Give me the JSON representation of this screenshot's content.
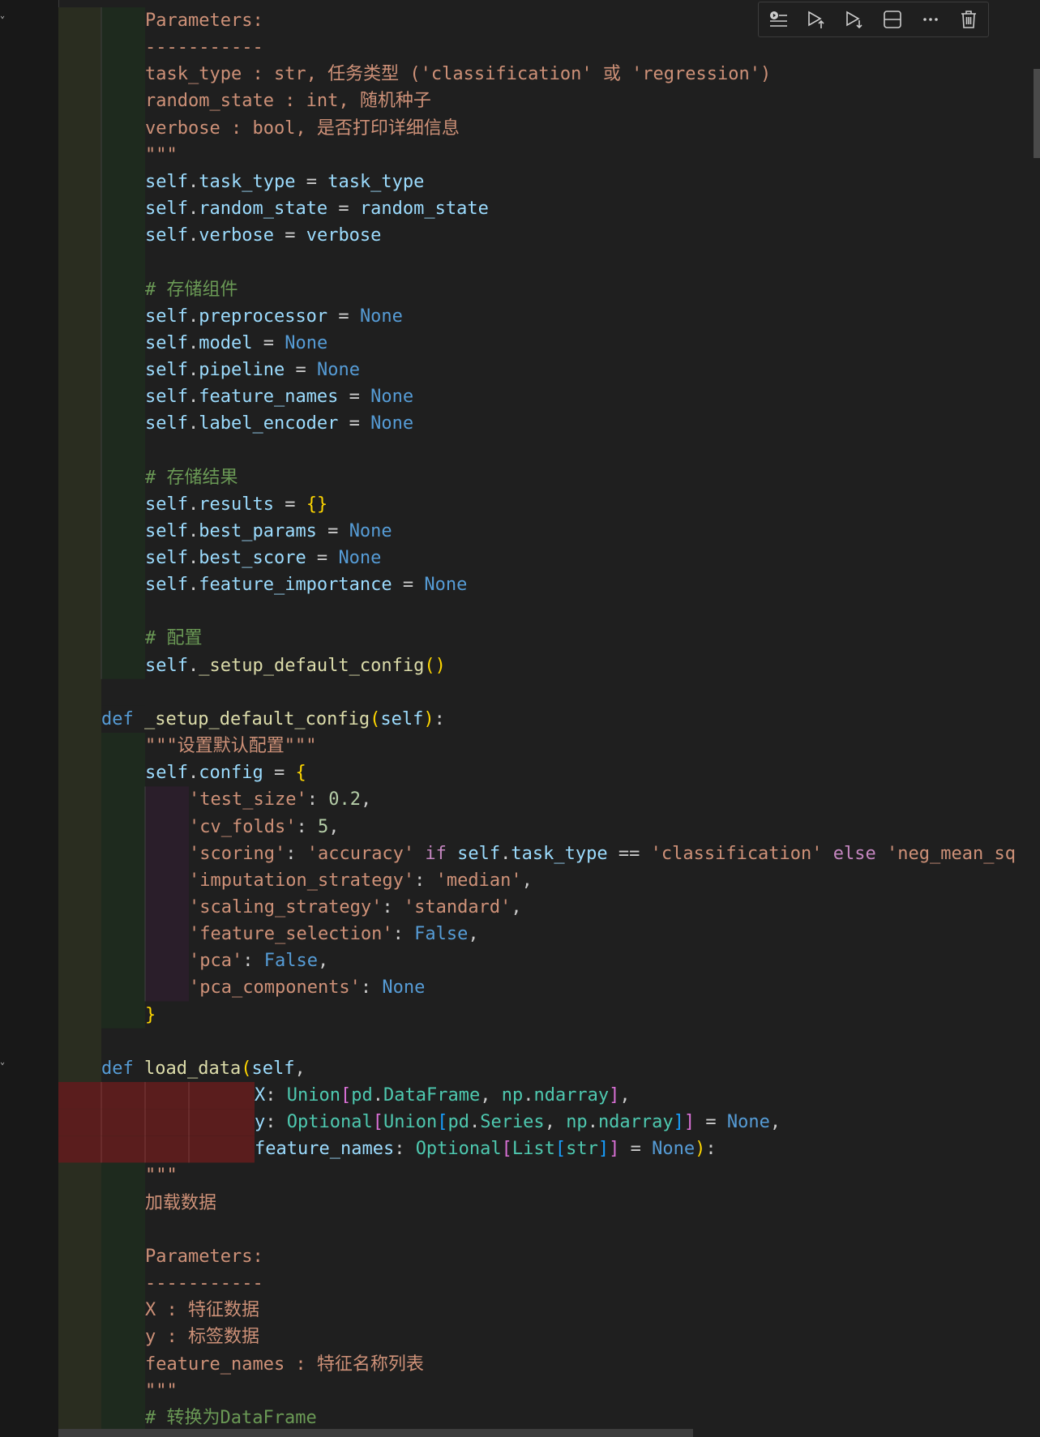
{
  "toolbar": {
    "buttons": [
      {
        "icon": "execute-above-icon",
        "label": "Execute above cells"
      },
      {
        "icon": "run-above-icon",
        "label": "Run above"
      },
      {
        "icon": "run-below-icon",
        "label": "Run below"
      },
      {
        "icon": "split-cell-icon",
        "label": "Split cell"
      },
      {
        "icon": "more-actions-icon",
        "label": "More actions"
      },
      {
        "icon": "delete-cell-icon",
        "label": "Delete cell"
      }
    ]
  },
  "colors": {
    "keyword": "#569cd6",
    "function": "#dcdcaa",
    "variable": "#9cdcfe",
    "string": "#ce9178",
    "comment": "#6a9955",
    "number": "#b5cea8",
    "type": "#4ec9b0",
    "bracket_gold": "#ffd700",
    "bracket_pink": "#da70d6",
    "bracket_blue": "#179fff",
    "control_keyword": "#c586c0",
    "error_highlight": "#5a1d1d",
    "indent_guide": "#2d3a2a",
    "background": "#1f1f1f"
  },
  "code": {
    "lines": [
      {
        "indent": 2,
        "parts": [
          {
            "c": "s",
            "t": "Parameters:"
          }
        ]
      },
      {
        "indent": 2,
        "parts": [
          {
            "c": "s",
            "t": "-----------"
          }
        ]
      },
      {
        "indent": 2,
        "parts": [
          {
            "c": "s",
            "t": "task_type : str, 任务类型 ('classification' 或 'regression')"
          }
        ]
      },
      {
        "indent": 2,
        "parts": [
          {
            "c": "s",
            "t": "random_state : int, 随机种子"
          }
        ]
      },
      {
        "indent": 2,
        "parts": [
          {
            "c": "s",
            "t": "verbose : bool, 是否打印详细信息"
          }
        ]
      },
      {
        "indent": 2,
        "parts": [
          {
            "c": "s",
            "t": "\"\"\""
          }
        ]
      },
      {
        "indent": 2,
        "parts": [
          {
            "c": "v",
            "t": "self"
          },
          {
            "c": "p",
            "t": "."
          },
          {
            "c": "v",
            "t": "task_type"
          },
          {
            "c": "p",
            "t": " = "
          },
          {
            "c": "v",
            "t": "task_type"
          }
        ]
      },
      {
        "indent": 2,
        "parts": [
          {
            "c": "v",
            "t": "self"
          },
          {
            "c": "p",
            "t": "."
          },
          {
            "c": "v",
            "t": "random_state"
          },
          {
            "c": "p",
            "t": " = "
          },
          {
            "c": "v",
            "t": "random_state"
          }
        ]
      },
      {
        "indent": 2,
        "parts": [
          {
            "c": "v",
            "t": "self"
          },
          {
            "c": "p",
            "t": "."
          },
          {
            "c": "v",
            "t": "verbose"
          },
          {
            "c": "p",
            "t": " = "
          },
          {
            "c": "v",
            "t": "verbose"
          }
        ]
      },
      {
        "indent": 2,
        "parts": []
      },
      {
        "indent": 2,
        "parts": [
          {
            "c": "c",
            "t": "# 存储组件"
          }
        ]
      },
      {
        "indent": 2,
        "parts": [
          {
            "c": "v",
            "t": "self"
          },
          {
            "c": "p",
            "t": "."
          },
          {
            "c": "v",
            "t": "preprocessor"
          },
          {
            "c": "p",
            "t": " = "
          },
          {
            "c": "k",
            "t": "None"
          }
        ]
      },
      {
        "indent": 2,
        "parts": [
          {
            "c": "v",
            "t": "self"
          },
          {
            "c": "p",
            "t": "."
          },
          {
            "c": "v",
            "t": "model"
          },
          {
            "c": "p",
            "t": " = "
          },
          {
            "c": "k",
            "t": "None"
          }
        ]
      },
      {
        "indent": 2,
        "parts": [
          {
            "c": "v",
            "t": "self"
          },
          {
            "c": "p",
            "t": "."
          },
          {
            "c": "v",
            "t": "pipeline"
          },
          {
            "c": "p",
            "t": " = "
          },
          {
            "c": "k",
            "t": "None"
          }
        ]
      },
      {
        "indent": 2,
        "parts": [
          {
            "c": "v",
            "t": "self"
          },
          {
            "c": "p",
            "t": "."
          },
          {
            "c": "v",
            "t": "feature_names"
          },
          {
            "c": "p",
            "t": " = "
          },
          {
            "c": "k",
            "t": "None"
          }
        ]
      },
      {
        "indent": 2,
        "parts": [
          {
            "c": "v",
            "t": "self"
          },
          {
            "c": "p",
            "t": "."
          },
          {
            "c": "v",
            "t": "label_encoder"
          },
          {
            "c": "p",
            "t": " = "
          },
          {
            "c": "k",
            "t": "None"
          }
        ]
      },
      {
        "indent": 2,
        "parts": []
      },
      {
        "indent": 2,
        "parts": [
          {
            "c": "c",
            "t": "# 存储结果"
          }
        ]
      },
      {
        "indent": 2,
        "parts": [
          {
            "c": "v",
            "t": "self"
          },
          {
            "c": "p",
            "t": "."
          },
          {
            "c": "v",
            "t": "results"
          },
          {
            "c": "p",
            "t": " = "
          },
          {
            "c": "br1",
            "t": "{}"
          }
        ]
      },
      {
        "indent": 2,
        "parts": [
          {
            "c": "v",
            "t": "self"
          },
          {
            "c": "p",
            "t": "."
          },
          {
            "c": "v",
            "t": "best_params"
          },
          {
            "c": "p",
            "t": " = "
          },
          {
            "c": "k",
            "t": "None"
          }
        ]
      },
      {
        "indent": 2,
        "parts": [
          {
            "c": "v",
            "t": "self"
          },
          {
            "c": "p",
            "t": "."
          },
          {
            "c": "v",
            "t": "best_score"
          },
          {
            "c": "p",
            "t": " = "
          },
          {
            "c": "k",
            "t": "None"
          }
        ]
      },
      {
        "indent": 2,
        "parts": [
          {
            "c": "v",
            "t": "self"
          },
          {
            "c": "p",
            "t": "."
          },
          {
            "c": "v",
            "t": "feature_importance"
          },
          {
            "c": "p",
            "t": " = "
          },
          {
            "c": "k",
            "t": "None"
          }
        ]
      },
      {
        "indent": 2,
        "parts": []
      },
      {
        "indent": 2,
        "parts": [
          {
            "c": "c",
            "t": "# 配置"
          }
        ]
      },
      {
        "indent": 2,
        "parts": [
          {
            "c": "v",
            "t": "self"
          },
          {
            "c": "p",
            "t": "."
          },
          {
            "c": "f",
            "t": "_setup_default_config"
          },
          {
            "c": "br1",
            "t": "()"
          }
        ]
      },
      {
        "indent": 1,
        "parts": []
      },
      {
        "indent": 1,
        "parts": [
          {
            "c": "k",
            "t": "def"
          },
          {
            "c": "p",
            "t": " "
          },
          {
            "c": "f",
            "t": "_setup_default_config"
          },
          {
            "c": "br1",
            "t": "("
          },
          {
            "c": "v",
            "t": "self"
          },
          {
            "c": "br1",
            "t": ")"
          },
          {
            "c": "p",
            "t": ":"
          }
        ]
      },
      {
        "indent": 2,
        "parts": [
          {
            "c": "s",
            "t": "\"\"\"设置默认配置\"\"\""
          }
        ]
      },
      {
        "indent": 2,
        "parts": [
          {
            "c": "v",
            "t": "self"
          },
          {
            "c": "p",
            "t": "."
          },
          {
            "c": "v",
            "t": "config"
          },
          {
            "c": "p",
            "t": " = "
          },
          {
            "c": "br1",
            "t": "{"
          }
        ]
      },
      {
        "indent": 3,
        "parts": [
          {
            "c": "s",
            "t": "'test_size'"
          },
          {
            "c": "p",
            "t": ": "
          },
          {
            "c": "n",
            "t": "0.2"
          },
          {
            "c": "p",
            "t": ","
          }
        ]
      },
      {
        "indent": 3,
        "parts": [
          {
            "c": "s",
            "t": "'cv_folds'"
          },
          {
            "c": "p",
            "t": ": "
          },
          {
            "c": "n",
            "t": "5"
          },
          {
            "c": "p",
            "t": ","
          }
        ]
      },
      {
        "indent": 3,
        "parts": [
          {
            "c": "s",
            "t": "'scoring'"
          },
          {
            "c": "p",
            "t": ": "
          },
          {
            "c": "s",
            "t": "'accuracy'"
          },
          {
            "c": "p",
            "t": " "
          },
          {
            "c": "kw2",
            "t": "if"
          },
          {
            "c": "p",
            "t": " "
          },
          {
            "c": "v",
            "t": "self"
          },
          {
            "c": "p",
            "t": "."
          },
          {
            "c": "v",
            "t": "task_type"
          },
          {
            "c": "p",
            "t": " == "
          },
          {
            "c": "s",
            "t": "'classification'"
          },
          {
            "c": "p",
            "t": " "
          },
          {
            "c": "kw2",
            "t": "else"
          },
          {
            "c": "p",
            "t": " "
          },
          {
            "c": "s",
            "t": "'neg_mean_sq"
          }
        ]
      },
      {
        "indent": 3,
        "parts": [
          {
            "c": "s",
            "t": "'imputation_strategy'"
          },
          {
            "c": "p",
            "t": ": "
          },
          {
            "c": "s",
            "t": "'median'"
          },
          {
            "c": "p",
            "t": ","
          }
        ]
      },
      {
        "indent": 3,
        "parts": [
          {
            "c": "s",
            "t": "'scaling_strategy'"
          },
          {
            "c": "p",
            "t": ": "
          },
          {
            "c": "s",
            "t": "'standard'"
          },
          {
            "c": "p",
            "t": ","
          }
        ]
      },
      {
        "indent": 3,
        "parts": [
          {
            "c": "s",
            "t": "'feature_selection'"
          },
          {
            "c": "p",
            "t": ": "
          },
          {
            "c": "k",
            "t": "False"
          },
          {
            "c": "p",
            "t": ","
          }
        ]
      },
      {
        "indent": 3,
        "parts": [
          {
            "c": "s",
            "t": "'pca'"
          },
          {
            "c": "p",
            "t": ": "
          },
          {
            "c": "k",
            "t": "False"
          },
          {
            "c": "p",
            "t": ","
          }
        ]
      },
      {
        "indent": 3,
        "parts": [
          {
            "c": "s",
            "t": "'pca_components'"
          },
          {
            "c": "p",
            "t": ": "
          },
          {
            "c": "k",
            "t": "None"
          }
        ]
      },
      {
        "indent": 2,
        "parts": [
          {
            "c": "br1",
            "t": "}"
          }
        ]
      },
      {
        "indent": 1,
        "parts": []
      },
      {
        "indent": 1,
        "parts": [
          {
            "c": "k",
            "t": "def"
          },
          {
            "c": "p",
            "t": " "
          },
          {
            "c": "f",
            "t": "load_data"
          },
          {
            "c": "br1",
            "t": "("
          },
          {
            "c": "v",
            "t": "self"
          },
          {
            "c": "p",
            "t": ","
          }
        ]
      },
      {
        "indent": 4.5,
        "error": true,
        "parts": [
          {
            "c": "v",
            "t": "X"
          },
          {
            "c": "p",
            "t": ": "
          },
          {
            "c": "t",
            "t": "Union"
          },
          {
            "c": "br2",
            "t": "["
          },
          {
            "c": "t",
            "t": "pd"
          },
          {
            "c": "p",
            "t": "."
          },
          {
            "c": "t",
            "t": "DataFrame"
          },
          {
            "c": "p",
            "t": ", "
          },
          {
            "c": "t",
            "t": "np"
          },
          {
            "c": "p",
            "t": "."
          },
          {
            "c": "t",
            "t": "ndarray"
          },
          {
            "c": "br2",
            "t": "]"
          },
          {
            "c": "p",
            "t": ","
          }
        ]
      },
      {
        "indent": 4.5,
        "error": true,
        "parts": [
          {
            "c": "v",
            "t": "y"
          },
          {
            "c": "p",
            "t": ": "
          },
          {
            "c": "t",
            "t": "Optional"
          },
          {
            "c": "br2",
            "t": "["
          },
          {
            "c": "t",
            "t": "Union"
          },
          {
            "c": "br3",
            "t": "["
          },
          {
            "c": "t",
            "t": "pd"
          },
          {
            "c": "p",
            "t": "."
          },
          {
            "c": "t",
            "t": "Series"
          },
          {
            "c": "p",
            "t": ", "
          },
          {
            "c": "t",
            "t": "np"
          },
          {
            "c": "p",
            "t": "."
          },
          {
            "c": "t",
            "t": "ndarray"
          },
          {
            "c": "br3",
            "t": "]"
          },
          {
            "c": "br2",
            "t": "]"
          },
          {
            "c": "p",
            "t": " = "
          },
          {
            "c": "k",
            "t": "None"
          },
          {
            "c": "p",
            "t": ","
          }
        ]
      },
      {
        "indent": 4.5,
        "error": true,
        "parts": [
          {
            "c": "v",
            "t": "feature_names"
          },
          {
            "c": "p",
            "t": ": "
          },
          {
            "c": "t",
            "t": "Optional"
          },
          {
            "c": "br2",
            "t": "["
          },
          {
            "c": "t",
            "t": "List"
          },
          {
            "c": "br3",
            "t": "["
          },
          {
            "c": "t",
            "t": "str"
          },
          {
            "c": "br3",
            "t": "]"
          },
          {
            "c": "br2",
            "t": "]"
          },
          {
            "c": "p",
            "t": " = "
          },
          {
            "c": "k",
            "t": "None"
          },
          {
            "c": "br1",
            "t": ")"
          },
          {
            "c": "p",
            "t": ":"
          }
        ]
      },
      {
        "indent": 2,
        "parts": [
          {
            "c": "s",
            "t": "\"\"\""
          }
        ]
      },
      {
        "indent": 2,
        "parts": [
          {
            "c": "s",
            "t": "加载数据"
          }
        ]
      },
      {
        "indent": 2,
        "parts": []
      },
      {
        "indent": 2,
        "parts": [
          {
            "c": "s",
            "t": "Parameters:"
          }
        ]
      },
      {
        "indent": 2,
        "parts": [
          {
            "c": "s",
            "t": "-----------"
          }
        ]
      },
      {
        "indent": 2,
        "parts": [
          {
            "c": "s",
            "t": "X : 特征数据"
          }
        ]
      },
      {
        "indent": 2,
        "parts": [
          {
            "c": "s",
            "t": "y : 标签数据"
          }
        ]
      },
      {
        "indent": 2,
        "parts": [
          {
            "c": "s",
            "t": "feature_names : 特征名称列表"
          }
        ]
      },
      {
        "indent": 2,
        "parts": [
          {
            "c": "s",
            "t": "\"\"\""
          }
        ]
      },
      {
        "indent": 2,
        "parts": [
          {
            "c": "c",
            "t": "# 转换为DataFrame"
          }
        ]
      }
    ]
  }
}
